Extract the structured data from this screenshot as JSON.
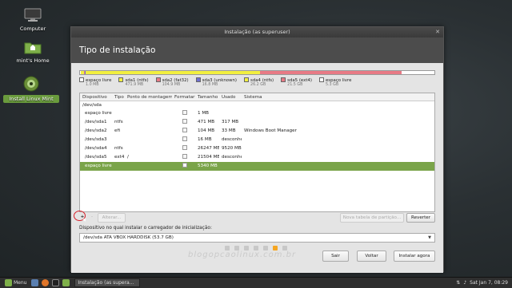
{
  "desktop": {
    "icons": [
      {
        "label": "Computer"
      },
      {
        "label": "mint's Home"
      },
      {
        "label": "Install Linux Mint"
      }
    ]
  },
  "window": {
    "title": "Instalação (as superuser)",
    "header": "Tipo de instalação"
  },
  "partitions_bar": [
    {
      "color": "#ffffff",
      "fraction": 0.003
    },
    {
      "color": "#f2ef3f",
      "fraction": 0.009
    },
    {
      "color": "#e87a85",
      "fraction": 0.002
    },
    {
      "color": "#6f6fd0",
      "fraction": 0.001
    },
    {
      "color": "#f2ef3f",
      "fraction": 0.492
    },
    {
      "color": "#e87a85",
      "fraction": 0.4
    },
    {
      "color": "#ffffff",
      "fraction": 0.093
    }
  ],
  "legend": [
    {
      "label": "espaço livre",
      "size": "1.0 MB",
      "color": "#ffffff"
    },
    {
      "label": "sda1 (ntfs)",
      "size": "471.9 MB",
      "color": "#f2ef3f"
    },
    {
      "label": "sda2 (fat32)",
      "size": "104.9 MB",
      "color": "#e87a85"
    },
    {
      "label": "sda3 (unknown)",
      "size": "16.8 MB",
      "color": "#6f6fd0"
    },
    {
      "label": "sda4 (ntfs)",
      "size": "26.2 GB",
      "color": "#f2ef3f"
    },
    {
      "label": "sda5 (ext4)",
      "size": "21.5 GB",
      "color": "#e87a85"
    },
    {
      "label": "espaço livre",
      "size": "5.3 GB",
      "color": "#ffffff"
    }
  ],
  "table": {
    "headers": [
      "Dispositivo",
      "Tipo",
      "Ponto de montagem",
      "Formatar?",
      "Tamanho",
      "Usado",
      "Sistema"
    ],
    "group": "/dev/sda",
    "rows": [
      {
        "device": "espaço livre",
        "type": "",
        "mount": "",
        "size": "1 MB",
        "used": "",
        "system": ""
      },
      {
        "device": "/dev/sda1",
        "type": "ntfs",
        "mount": "",
        "size": "471 MB",
        "used": "317 MB",
        "system": ""
      },
      {
        "device": "/dev/sda2",
        "type": "efi",
        "mount": "",
        "size": "104 MB",
        "used": "33 MB",
        "system": "Windows Boot Manager"
      },
      {
        "device": "/dev/sda3",
        "type": "",
        "mount": "",
        "size": "16 MB",
        "used": "desconhecido",
        "system": ""
      },
      {
        "device": "/dev/sda4",
        "type": "ntfs",
        "mount": "",
        "size": "26247 MB",
        "used": "9520 MB",
        "system": ""
      },
      {
        "device": "/dev/sda5",
        "type": "ext4",
        "mount": "/",
        "size": "21504 MB",
        "used": "desconhecido",
        "system": ""
      },
      {
        "device": "espaço livre",
        "type": "",
        "mount": "",
        "size": "5340 MB",
        "used": "",
        "system": ""
      }
    ]
  },
  "buttons": {
    "add": "+",
    "remove": "-",
    "change": "Alterar...",
    "new_table": "Nova tabela de partição...",
    "revert": "Reverter",
    "quit": "Sair",
    "back": "Voltar",
    "install": "Instalar agora"
  },
  "bootloader": {
    "label": "Dispositivo no qual instalar o carregador de inicialização:",
    "value": "/dev/sda   ATA VBOX HARDDISK (53.7 GB)"
  },
  "progress": {
    "total_steps": 7,
    "current_step": 6
  },
  "watermark": "blogopcaolinux.com.br",
  "taskbar": {
    "menu_label": "Menu",
    "task_label": "Instalação (as supera...",
    "clock": "Sat Jan  7, 08:29"
  }
}
